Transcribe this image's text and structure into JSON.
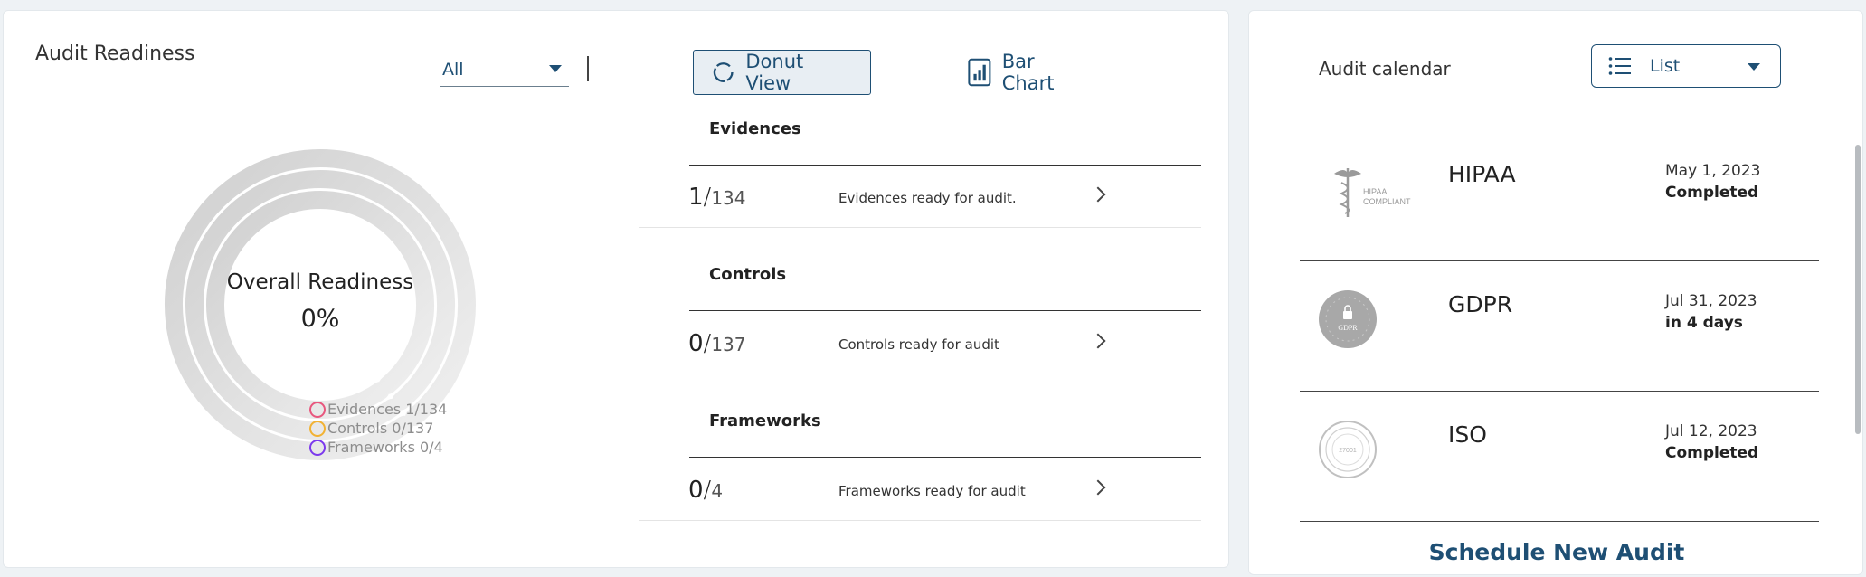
{
  "readiness": {
    "title": "Audit Readiness",
    "filter_value": "All",
    "view_toggle": {
      "donut_label": "Donut View",
      "bar_label": "Bar Chart",
      "active": "donut"
    },
    "overall_label": "Overall Readiness",
    "overall_value": "0%",
    "legend": [
      {
        "label": "Evidences 1/134",
        "color": "#e8577e"
      },
      {
        "label": "Controls 0/137",
        "color": "#f2b233"
      },
      {
        "label": "Frameworks 0/4",
        "color": "#7c3aed"
      }
    ],
    "sections": [
      {
        "title": "Evidences",
        "count": "1",
        "total": "134",
        "description": "Evidences ready for audit."
      },
      {
        "title": "Controls",
        "count": "0",
        "total": "137",
        "description": "Controls ready for audit"
      },
      {
        "title": "Frameworks",
        "count": "0",
        "total": "4",
        "description": "Frameworks ready for audit"
      }
    ]
  },
  "calendar": {
    "title": "Audit calendar",
    "view_value": "List",
    "audits": [
      {
        "name": "HIPAA",
        "date": "May 1, 2023",
        "status": "Completed",
        "logo": "hipaa-logo",
        "logo_text": [
          "HIPAA",
          "COMPLIANT"
        ]
      },
      {
        "name": "GDPR",
        "date": "Jul 31, 2023",
        "status": "in 4 days",
        "logo": "gdpr-logo",
        "logo_text": [
          "GDPR"
        ]
      },
      {
        "name": "ISO",
        "date": "Jul 12, 2023",
        "status": "Completed",
        "logo": "iso-logo",
        "logo_text": [
          "27001"
        ]
      }
    ],
    "schedule_label": "Schedule New Audit"
  }
}
